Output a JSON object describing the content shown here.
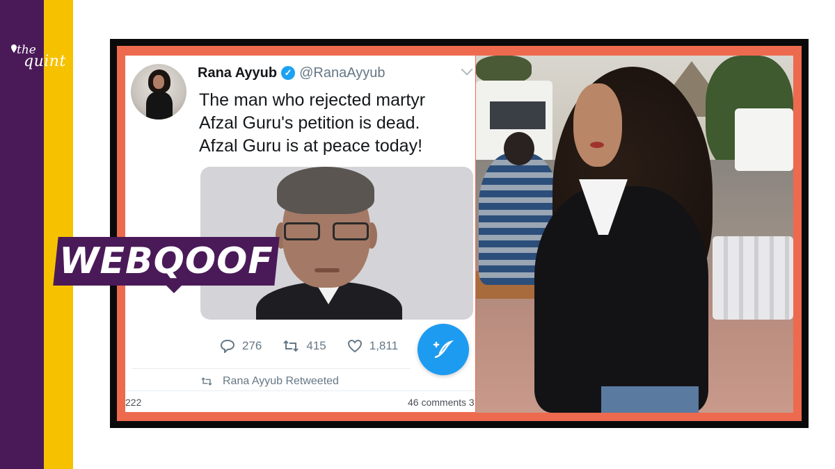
{
  "brand": {
    "logo_line1": "the",
    "logo_line2": "quint"
  },
  "badge": {
    "label": "WEBQOOF"
  },
  "tweet": {
    "author_name": "Rana Ayyub",
    "verified_mark": "✓",
    "handle": "@RanaAyyub",
    "text": "The man who rejected martyr\nAfzal Guru's petition is dead.\nAfzal Guru is at peace today!",
    "replies": "276",
    "retweets": "415",
    "likes": "1,811",
    "retweeted_by": "Rana Ayyub Retweeted",
    "footer_left": "222",
    "footer_right": "46 comments  3"
  },
  "icons": {
    "reply": "reply-icon",
    "retweet": "retweet-icon",
    "like": "heart-icon",
    "compose": "compose-icon",
    "verified": "verified-badge-icon"
  },
  "colors": {
    "brand_purple": "#4a1a58",
    "brand_yellow": "#f6c200",
    "frame_border": "#ed6a4f",
    "twitter_blue": "#1d9bf0"
  }
}
